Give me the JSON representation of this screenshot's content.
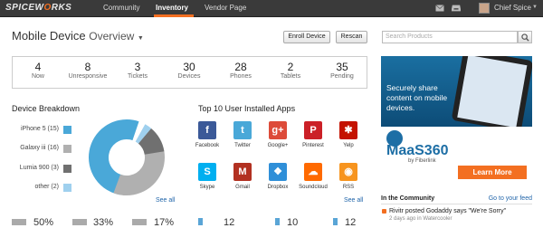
{
  "nav": {
    "logo_pre": "SPICEW",
    "logo_o": "O",
    "logo_post": "RKS",
    "items": [
      "Community",
      "Inventory",
      "Vendor Page"
    ],
    "user": "Chief Spice"
  },
  "header": {
    "title": "Mobile Device",
    "subtitle": "Overview",
    "enroll_button": "Enroll Device",
    "rescan_button": "Rescan",
    "search_placeholder": "Search Products"
  },
  "stats": [
    {
      "value": "4",
      "label": "Now"
    },
    {
      "value": "8",
      "label": "Unresponsive"
    },
    {
      "value": "3",
      "label": "Tickets"
    },
    {
      "value": "30",
      "label": "Devices"
    },
    {
      "value": "28",
      "label": "Phones"
    },
    {
      "value": "2",
      "label": "Tablets"
    },
    {
      "value": "35",
      "label": "Pending"
    }
  ],
  "breakdown": {
    "title": "Device Breakdown",
    "items": [
      {
        "label": "iPhone 5 (15)",
        "color": "#4aa8d8"
      },
      {
        "label": "Galaxy iii (16)",
        "color": "#b0b0b0"
      },
      {
        "label": "Lumia 900 (3)",
        "color": "#707070"
      },
      {
        "label": "other (2)",
        "color": "#9fd0ee"
      }
    ],
    "see_all": "See all"
  },
  "apps": {
    "title": "Top 10 User Installed Apps",
    "items": [
      {
        "name": "Facebook",
        "color": "#3b5998",
        "glyph": "f",
        "icon": "facebook-icon"
      },
      {
        "name": "Twitter",
        "color": "#4aa8d8",
        "glyph": "t",
        "icon": "twitter-icon"
      },
      {
        "name": "Google+",
        "color": "#dd4b39",
        "glyph": "g+",
        "icon": "google-plus-icon"
      },
      {
        "name": "Pinterest",
        "color": "#cb2027",
        "glyph": "P",
        "icon": "pinterest-icon"
      },
      {
        "name": "Yelp",
        "color": "#c41200",
        "glyph": "✱",
        "icon": "yelp-icon"
      },
      {
        "name": "Skype",
        "color": "#00aff0",
        "glyph": "S",
        "icon": "skype-icon"
      },
      {
        "name": "Gmail",
        "color": "#b23121",
        "glyph": "M",
        "icon": "gmail-icon"
      },
      {
        "name": "Dropbox",
        "color": "#2f8fd8",
        "glyph": "❖",
        "icon": "dropbox-icon"
      },
      {
        "name": "Soundcloud",
        "color": "#ff6a00",
        "glyph": "☁",
        "icon": "soundcloud-icon"
      },
      {
        "name": "RSS",
        "color": "#f7941e",
        "glyph": "◉",
        "icon": "rss-icon"
      }
    ],
    "see_all": "See all"
  },
  "ad": {
    "text": "Securely share content on mobile devices.",
    "brand": "MaaS360",
    "by": "by Fiberlink",
    "cta": "Learn More"
  },
  "community": {
    "title": "In the Community",
    "link": "Go to your feed",
    "post": "Rivitr posted Godaddy says \"We're Sorry\"",
    "meta": "2 days ago in Watercooler"
  },
  "bottom": [
    "50%",
    "33%",
    "17%",
    "12",
    "10",
    "12"
  ]
}
